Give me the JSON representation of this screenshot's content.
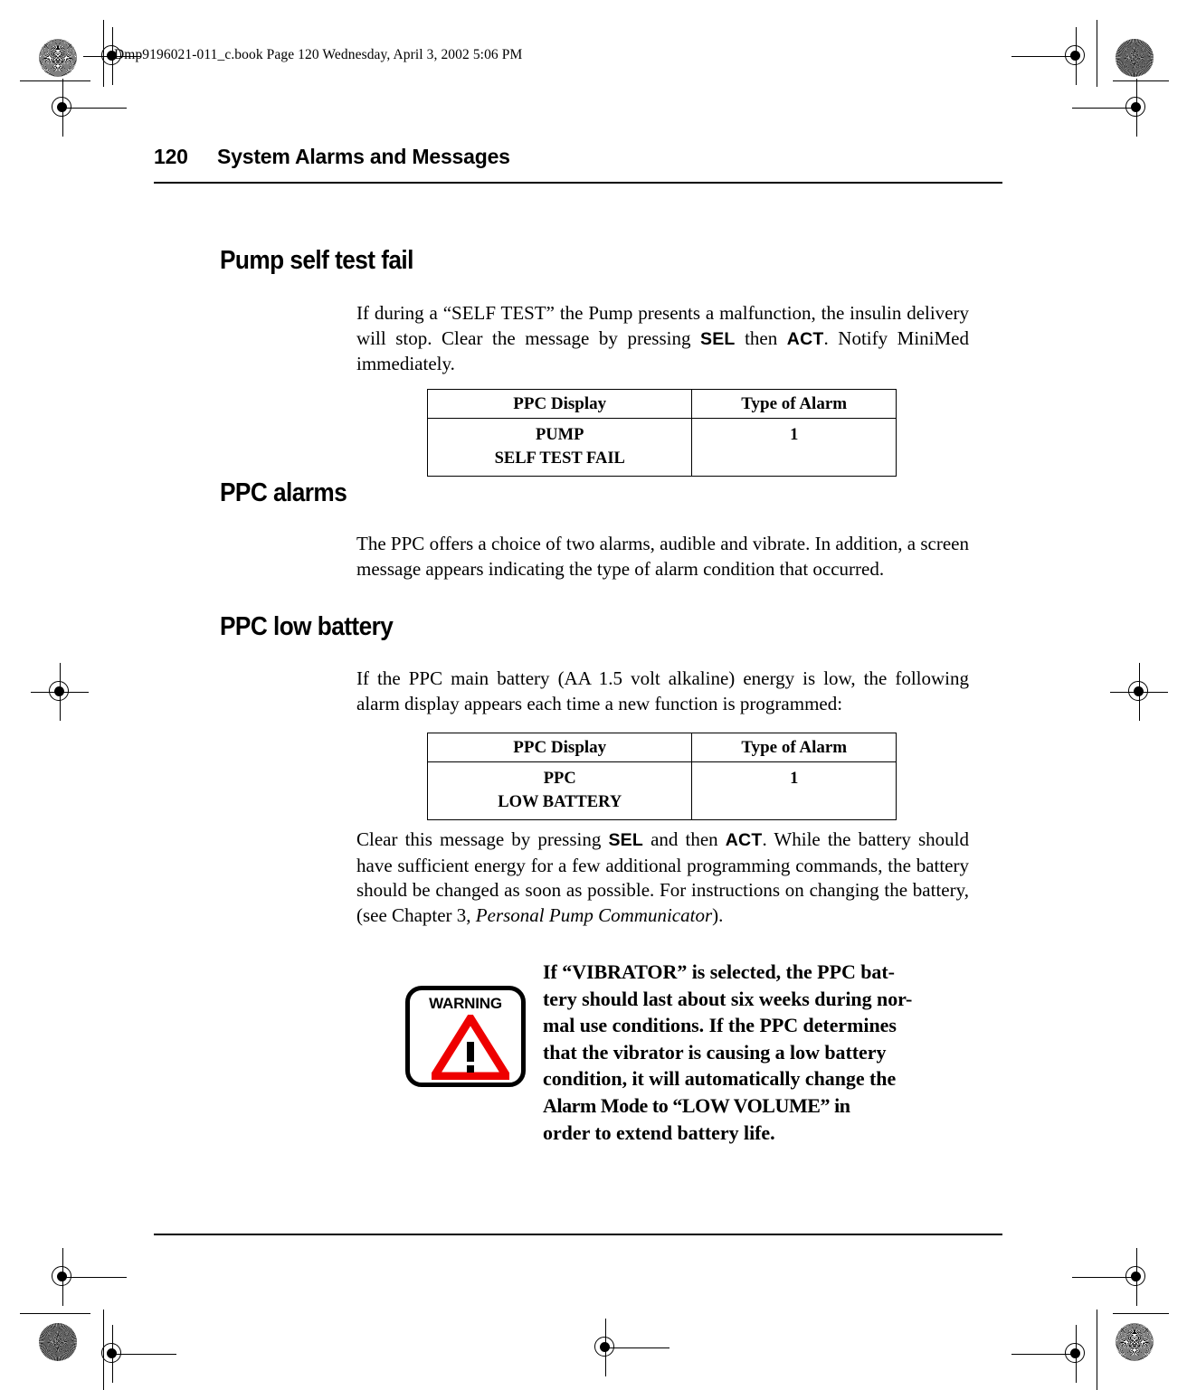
{
  "file_header": "Dmp9196021-011_c.book  Page 120  Wednesday, April 3, 2002  5:06 PM",
  "running_head": {
    "folio": "120",
    "title": "System Alarms and Messages"
  },
  "sections": [
    {
      "heading": "Pump self test fail",
      "paragraph_html": "If during a “SELF TEST”  the Pump presents a malfunction, the insulin delivery will stop. Clear the message by pressing <b class=\"key\">SEL</b> then <b class=\"key\">ACT</b>. Notify MiniMed immediately."
    },
    {
      "heading": "PPC alarms",
      "paragraph_html": "The PPC offers a choice of two alarms, audible and vibrate. In addition, a screen message appears indicating the type of alarm condition that occurred."
    },
    {
      "heading": "PPC low battery",
      "paragraph_html": "If the PPC main battery (AA 1.5 volt alkaline) energy is low, the following alarm display appears each time a new function is programmed:"
    }
  ],
  "closing_paragraph_html": "Clear this message by pressing <b class=\"key\">SEL</b> and then <b class=\"key\">ACT</b>. While the battery should have sufficient energy for a few additional programming commands, the battery should be changed as soon as possible.  For instructions on changing the battery, (see Chapter 3, <i>Personal Pump Communicator</i>).",
  "tables": [
    {
      "headers": [
        "PPC Display",
        "Type of Alarm"
      ],
      "rows": [
        {
          "display_line1": "PUMP",
          "display_line2": "SELF TEST FAIL",
          "alarm_type": "1"
        }
      ]
    },
    {
      "headers": [
        "PPC Display",
        "Type of Alarm"
      ],
      "rows": [
        {
          "display_line1": "PPC",
          "display_line2": "LOW BATTERY",
          "alarm_type": "1"
        }
      ]
    }
  ],
  "warning": {
    "icon_label": "WARNING",
    "icon_glyph": "!",
    "triangle_color": "#ee0000",
    "lines": [
      "If “VIBRATOR” is selected, the PPC bat-",
      "tery should last about six weeks during nor-",
      "mal use conditions.  If the PPC determines",
      "that the vibrator is causing a low battery",
      "condition, it will automatically change the",
      "Alarm Mode to “LOW VOLUME” in",
      "order to extend battery life."
    ]
  }
}
